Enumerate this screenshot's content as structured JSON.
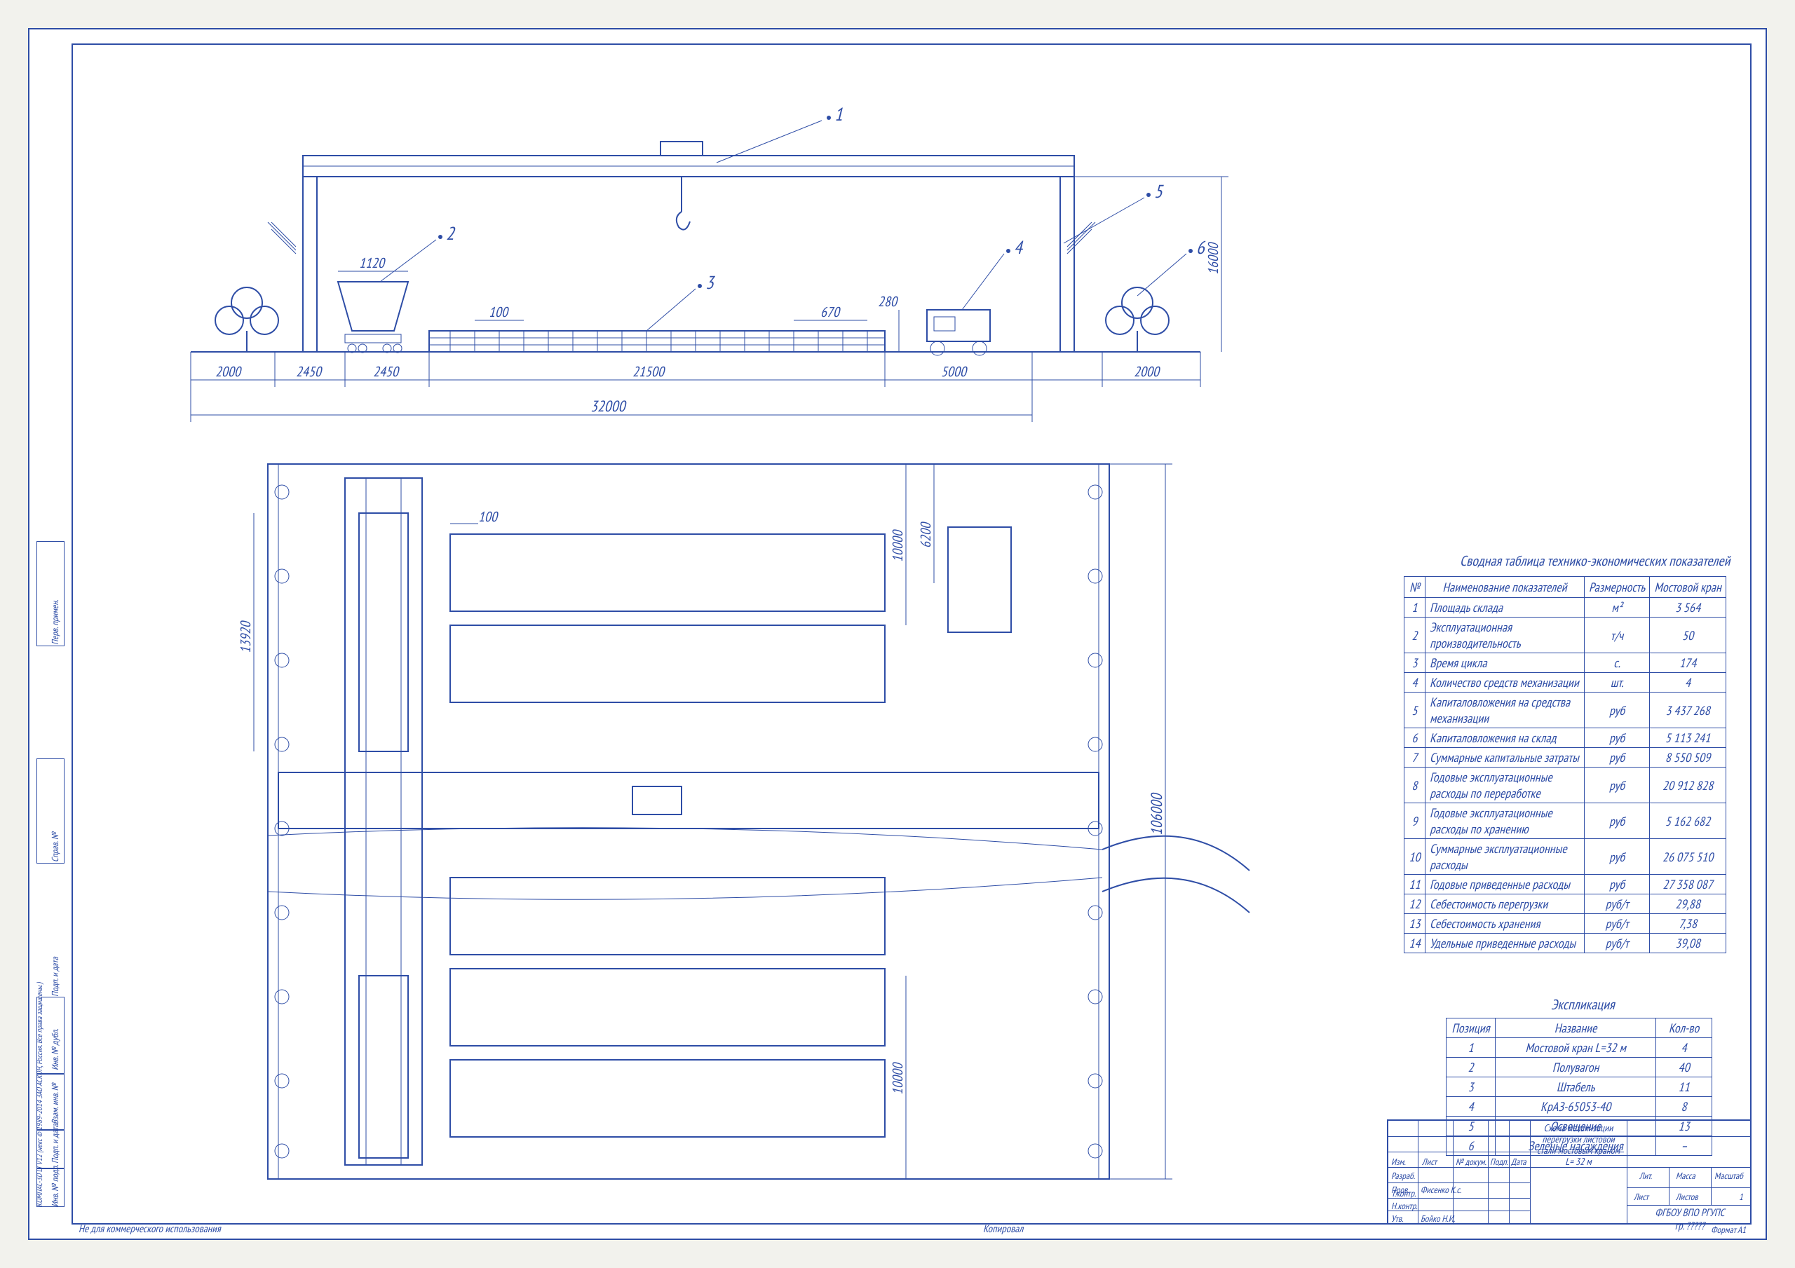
{
  "summary_title": "Сводная таблица технико-экономических показателей",
  "summary_headers": [
    "№",
    "Наименование показателей",
    "Размерность",
    "Мостовой кран"
  ],
  "summary_rows": [
    {
      "n": "1",
      "name": "Площадь склада",
      "unit": "м²",
      "val": "3 564"
    },
    {
      "n": "2",
      "name": "Эксплуатационная производительность",
      "unit": "т/ч",
      "val": "50"
    },
    {
      "n": "3",
      "name": "Время цикла",
      "unit": "с.",
      "val": "174"
    },
    {
      "n": "4",
      "name": "Количество средств механизации",
      "unit": "шт.",
      "val": "4"
    },
    {
      "n": "5",
      "name": "Капиталовложения на средства механизации",
      "unit": "руб",
      "val": "3 437 268"
    },
    {
      "n": "6",
      "name": "Капиталовложения на склад",
      "unit": "руб",
      "val": "5 113 241"
    },
    {
      "n": "7",
      "name": "Суммарные капитальные затраты",
      "unit": "руб",
      "val": "8 550 509"
    },
    {
      "n": "8",
      "name": "Годовые эксплуатационные расходы по переработке",
      "unit": "руб",
      "val": "20 912 828"
    },
    {
      "n": "9",
      "name": "Годовые эксплуатационные расходы по хранению",
      "unit": "руб",
      "val": "5 162 682"
    },
    {
      "n": "10",
      "name": "Суммарные эксплуатационные расходы",
      "unit": "руб",
      "val": "26 075 510"
    },
    {
      "n": "11",
      "name": "Годовые приведенные расходы",
      "unit": "руб",
      "val": "27 358 087"
    },
    {
      "n": "12",
      "name": "Себестоимость перегрузки",
      "unit": "руб/т",
      "val": "29,88"
    },
    {
      "n": "13",
      "name": "Себестоимость хранения",
      "unit": "руб/т",
      "val": "7,38"
    },
    {
      "n": "14",
      "name": "Удельные приведенные расходы",
      "unit": "руб/т",
      "val": "39,08"
    }
  ],
  "explic_title": "Экспликация",
  "explic_headers": [
    "Позиция",
    "Название",
    "Кол-во"
  ],
  "explic_rows": [
    {
      "p": "1",
      "name": "Мостовой кран L=32 м",
      "q": "4"
    },
    {
      "p": "2",
      "name": "Полувагон",
      "q": "40"
    },
    {
      "p": "3",
      "name": "Штабель",
      "q": "11"
    },
    {
      "p": "4",
      "name": "КрАЗ-65053-40",
      "q": "8"
    },
    {
      "p": "5",
      "name": "Освещение",
      "q": "13"
    },
    {
      "p": "6",
      "name": "Зеленые насаждения",
      "q": "–"
    }
  ],
  "callouts": {
    "c1": "1",
    "c2": "2",
    "c3": "3",
    "c4": "4",
    "c5": "5",
    "c6": "6"
  },
  "dims": {
    "d2000a": "2000",
    "d2450a": "2450",
    "d2450b": "2450",
    "d21500": "21500",
    "d5000": "5000",
    "d2000b": "2000",
    "d32000": "32000",
    "d1120": "1120",
    "d100a": "100",
    "d670": "670",
    "d280": "280",
    "d16000": "16000",
    "d100b": "100",
    "d13920": "13920",
    "d10000a": "10000",
    "d6200": "6200",
    "d10000b": "10000",
    "d106000": "106000"
  },
  "tb": {
    "main_title": "Схема механизации перегрузки листовой стали мостовым краном L= 32 м",
    "org": "ФГБОУ ВПО РГУПС",
    "grp": "гр. ?????",
    "fmt": "Формат   А1",
    "h_izm": "Изм.",
    "h_list": "Лист",
    "h_dok": "№ докум.",
    "h_podp": "Подп.",
    "h_data": "Дата",
    "r_raz": "Разраб.",
    "r_prov": "Пров.",
    "r_tk": "Т.контр.",
    "r_nk": "Н.контр.",
    "r_utv": "Утв.",
    "n_fis": "Фисенко К.с.",
    "n_boj": "Бойко Н.И.",
    "lit": "Лит.",
    "massa": "Масса",
    "masht": "Масштаб",
    "list": "Лист",
    "listov": "Листов",
    "one": "1",
    "kop": "Копировал"
  },
  "margin": {
    "nc": "Не для коммерческого использования",
    "kompas": "КОМПАС-3D LT V12 (некс © 1989-2014 ЗАО АСКОН, Россия. Все права защищены.)",
    "s1": "Инв. № подл.",
    "s2": "Подп. и дата",
    "s3": "Взам. инв. №",
    "s4": "Инв. № дубл.",
    "s5": "Подп. и дата",
    "s6": "Справ. №",
    "s7": "Перв. примен."
  }
}
